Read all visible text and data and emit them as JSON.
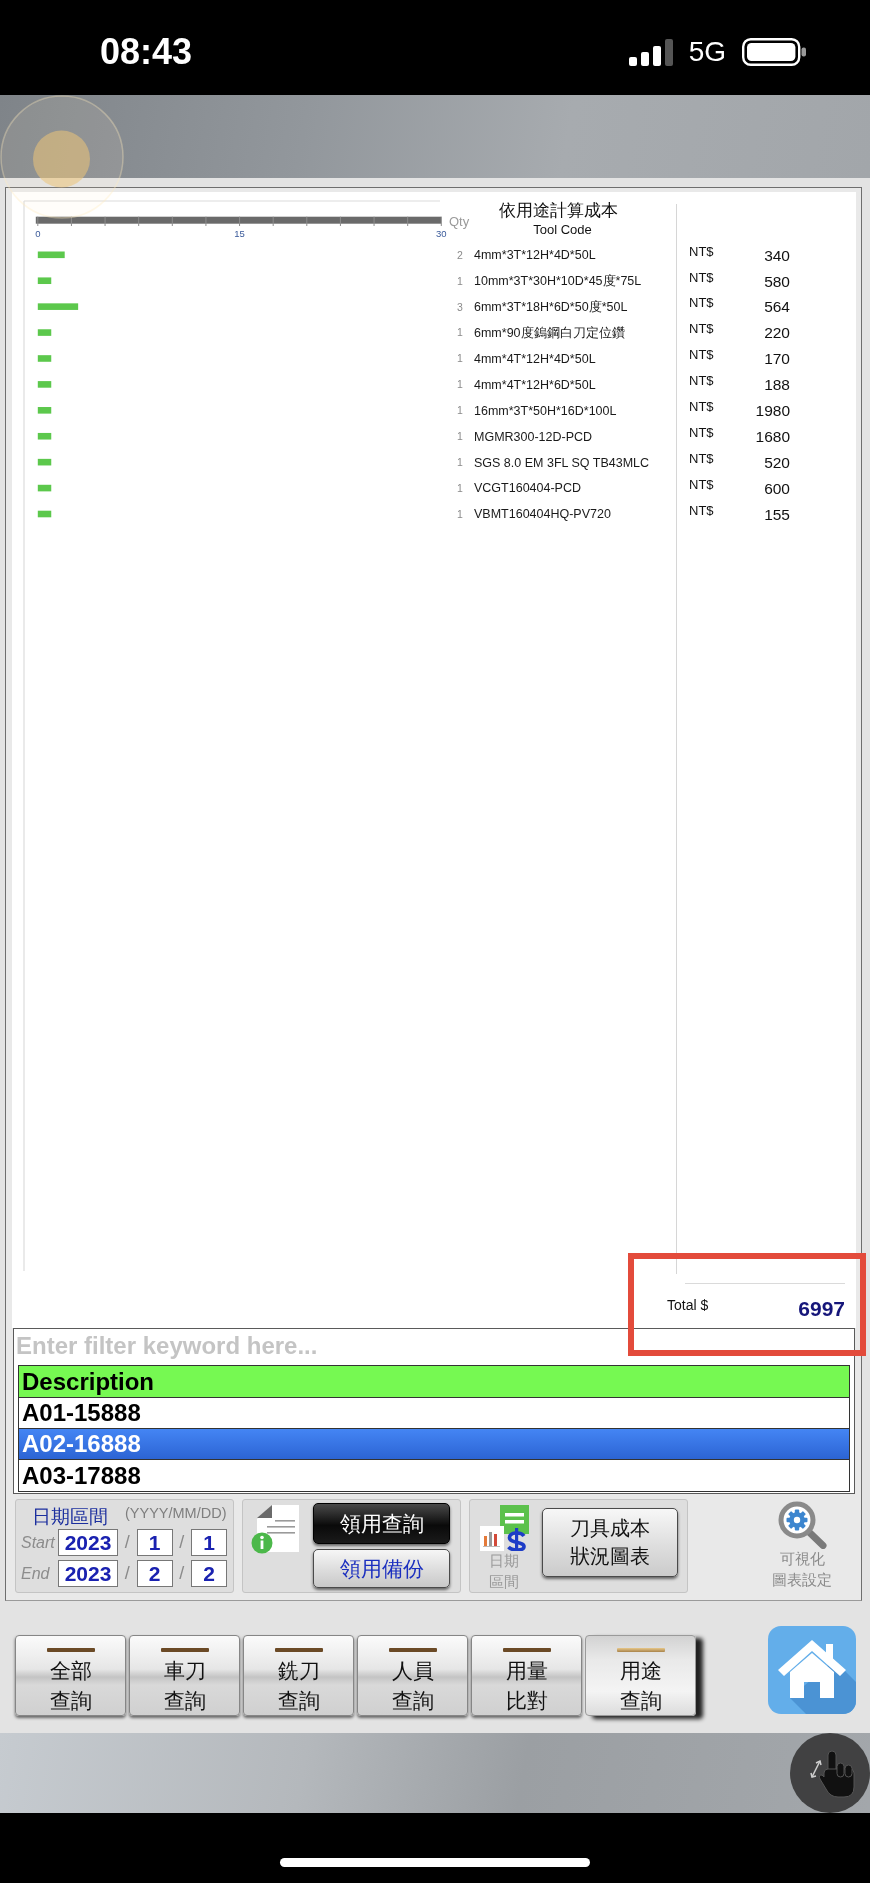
{
  "status_bar": {
    "time": "08:43",
    "network": "5G"
  },
  "chart": {
    "chart_data": {
      "type": "bar",
      "orientation": "horizontal",
      "title": "依用途計算成本",
      "xlabel": "Qty",
      "ylabel": "Tool Code",
      "categories": [
        "4mm*3T*12H*4D*50L",
        "10mm*3T*30H*10D*45度*75L",
        "6mm*3T*18H*6D*50度*50L",
        "6mm*90度鎢鋼白刀定位鑽",
        "4mm*4T*12H*4D*50L",
        "4mm*4T*12H*6D*50L",
        "16mm*3T*50H*16D*100L",
        "MGMR300-12D-PCD",
        "SGS 8.0 EM 3FL SQ TB43MLC",
        "VCGT160404-PCD",
        "VBMT160404HQ-PV720"
      ],
      "values": [
        2,
        1,
        3,
        1,
        1,
        1,
        1,
        1,
        1,
        1,
        1
      ],
      "xlim": [
        0,
        30
      ],
      "xticks": [
        0,
        15,
        30
      ],
      "data_labels": true
    }
  },
  "costs": [
    {
      "currency": "NT$",
      "amount": "340"
    },
    {
      "currency": "NT$",
      "amount": "580"
    },
    {
      "currency": "NT$",
      "amount": "564"
    },
    {
      "currency": "NT$",
      "amount": "220"
    },
    {
      "currency": "NT$",
      "amount": "170"
    },
    {
      "currency": "NT$",
      "amount": "188"
    },
    {
      "currency": "NT$",
      "amount": "1980"
    },
    {
      "currency": "NT$",
      "amount": "1680"
    },
    {
      "currency": "NT$",
      "amount": "520"
    },
    {
      "currency": "NT$",
      "amount": "600"
    },
    {
      "currency": "NT$",
      "amount": "155"
    }
  ],
  "total": {
    "label": "Total $",
    "value": "6997"
  },
  "filter": {
    "placeholder": "Enter filter keyword here..."
  },
  "list": {
    "header": "Description",
    "rows": [
      {
        "text": "A01-15888",
        "selected": false
      },
      {
        "text": "A02-16888",
        "selected": true
      },
      {
        "text": "A03-17888",
        "selected": false
      }
    ]
  },
  "date_range": {
    "title": "日期區間",
    "format": "(YYYY/MM/DD)",
    "rows": [
      {
        "label": "Start",
        "parts": [
          {
            "kind": "field",
            "text": "2023"
          },
          {
            "kind": "separator",
            "text": "/"
          },
          {
            "kind": "field",
            "text": "1"
          },
          {
            "kind": "separator",
            "text": "/"
          },
          {
            "kind": "field",
            "text": "1"
          }
        ]
      },
      {
        "label": "End",
        "parts": [
          {
            "kind": "field",
            "text": "2023"
          },
          {
            "kind": "separator",
            "text": "/"
          },
          {
            "kind": "field",
            "text": "2"
          },
          {
            "kind": "separator",
            "text": "/"
          },
          {
            "kind": "field",
            "text": "2"
          }
        ]
      }
    ]
  },
  "record_buttons": [
    {
      "label": "領用查詢",
      "kind": "dark"
    },
    {
      "label": "領用備份",
      "kind": "light"
    }
  ],
  "report": {
    "caption_lines": [
      "日期",
      "區間"
    ],
    "button_lines": [
      "刀具成本",
      "狀況圖表"
    ]
  },
  "chart_settings": {
    "caption_lines": [
      "可視化",
      "圖表設定"
    ]
  },
  "tabs": [
    {
      "lines": [
        "全部",
        "查詢"
      ],
      "selected": false
    },
    {
      "lines": [
        "車刀",
        "查詢"
      ],
      "selected": false
    },
    {
      "lines": [
        "銑刀",
        "查詢"
      ],
      "selected": false
    },
    {
      "lines": [
        "人員",
        "查詢"
      ],
      "selected": false
    },
    {
      "lines": [
        "用量",
        "比對"
      ],
      "selected": false
    },
    {
      "lines": [
        "用途",
        "查詢"
      ],
      "selected": true
    }
  ]
}
